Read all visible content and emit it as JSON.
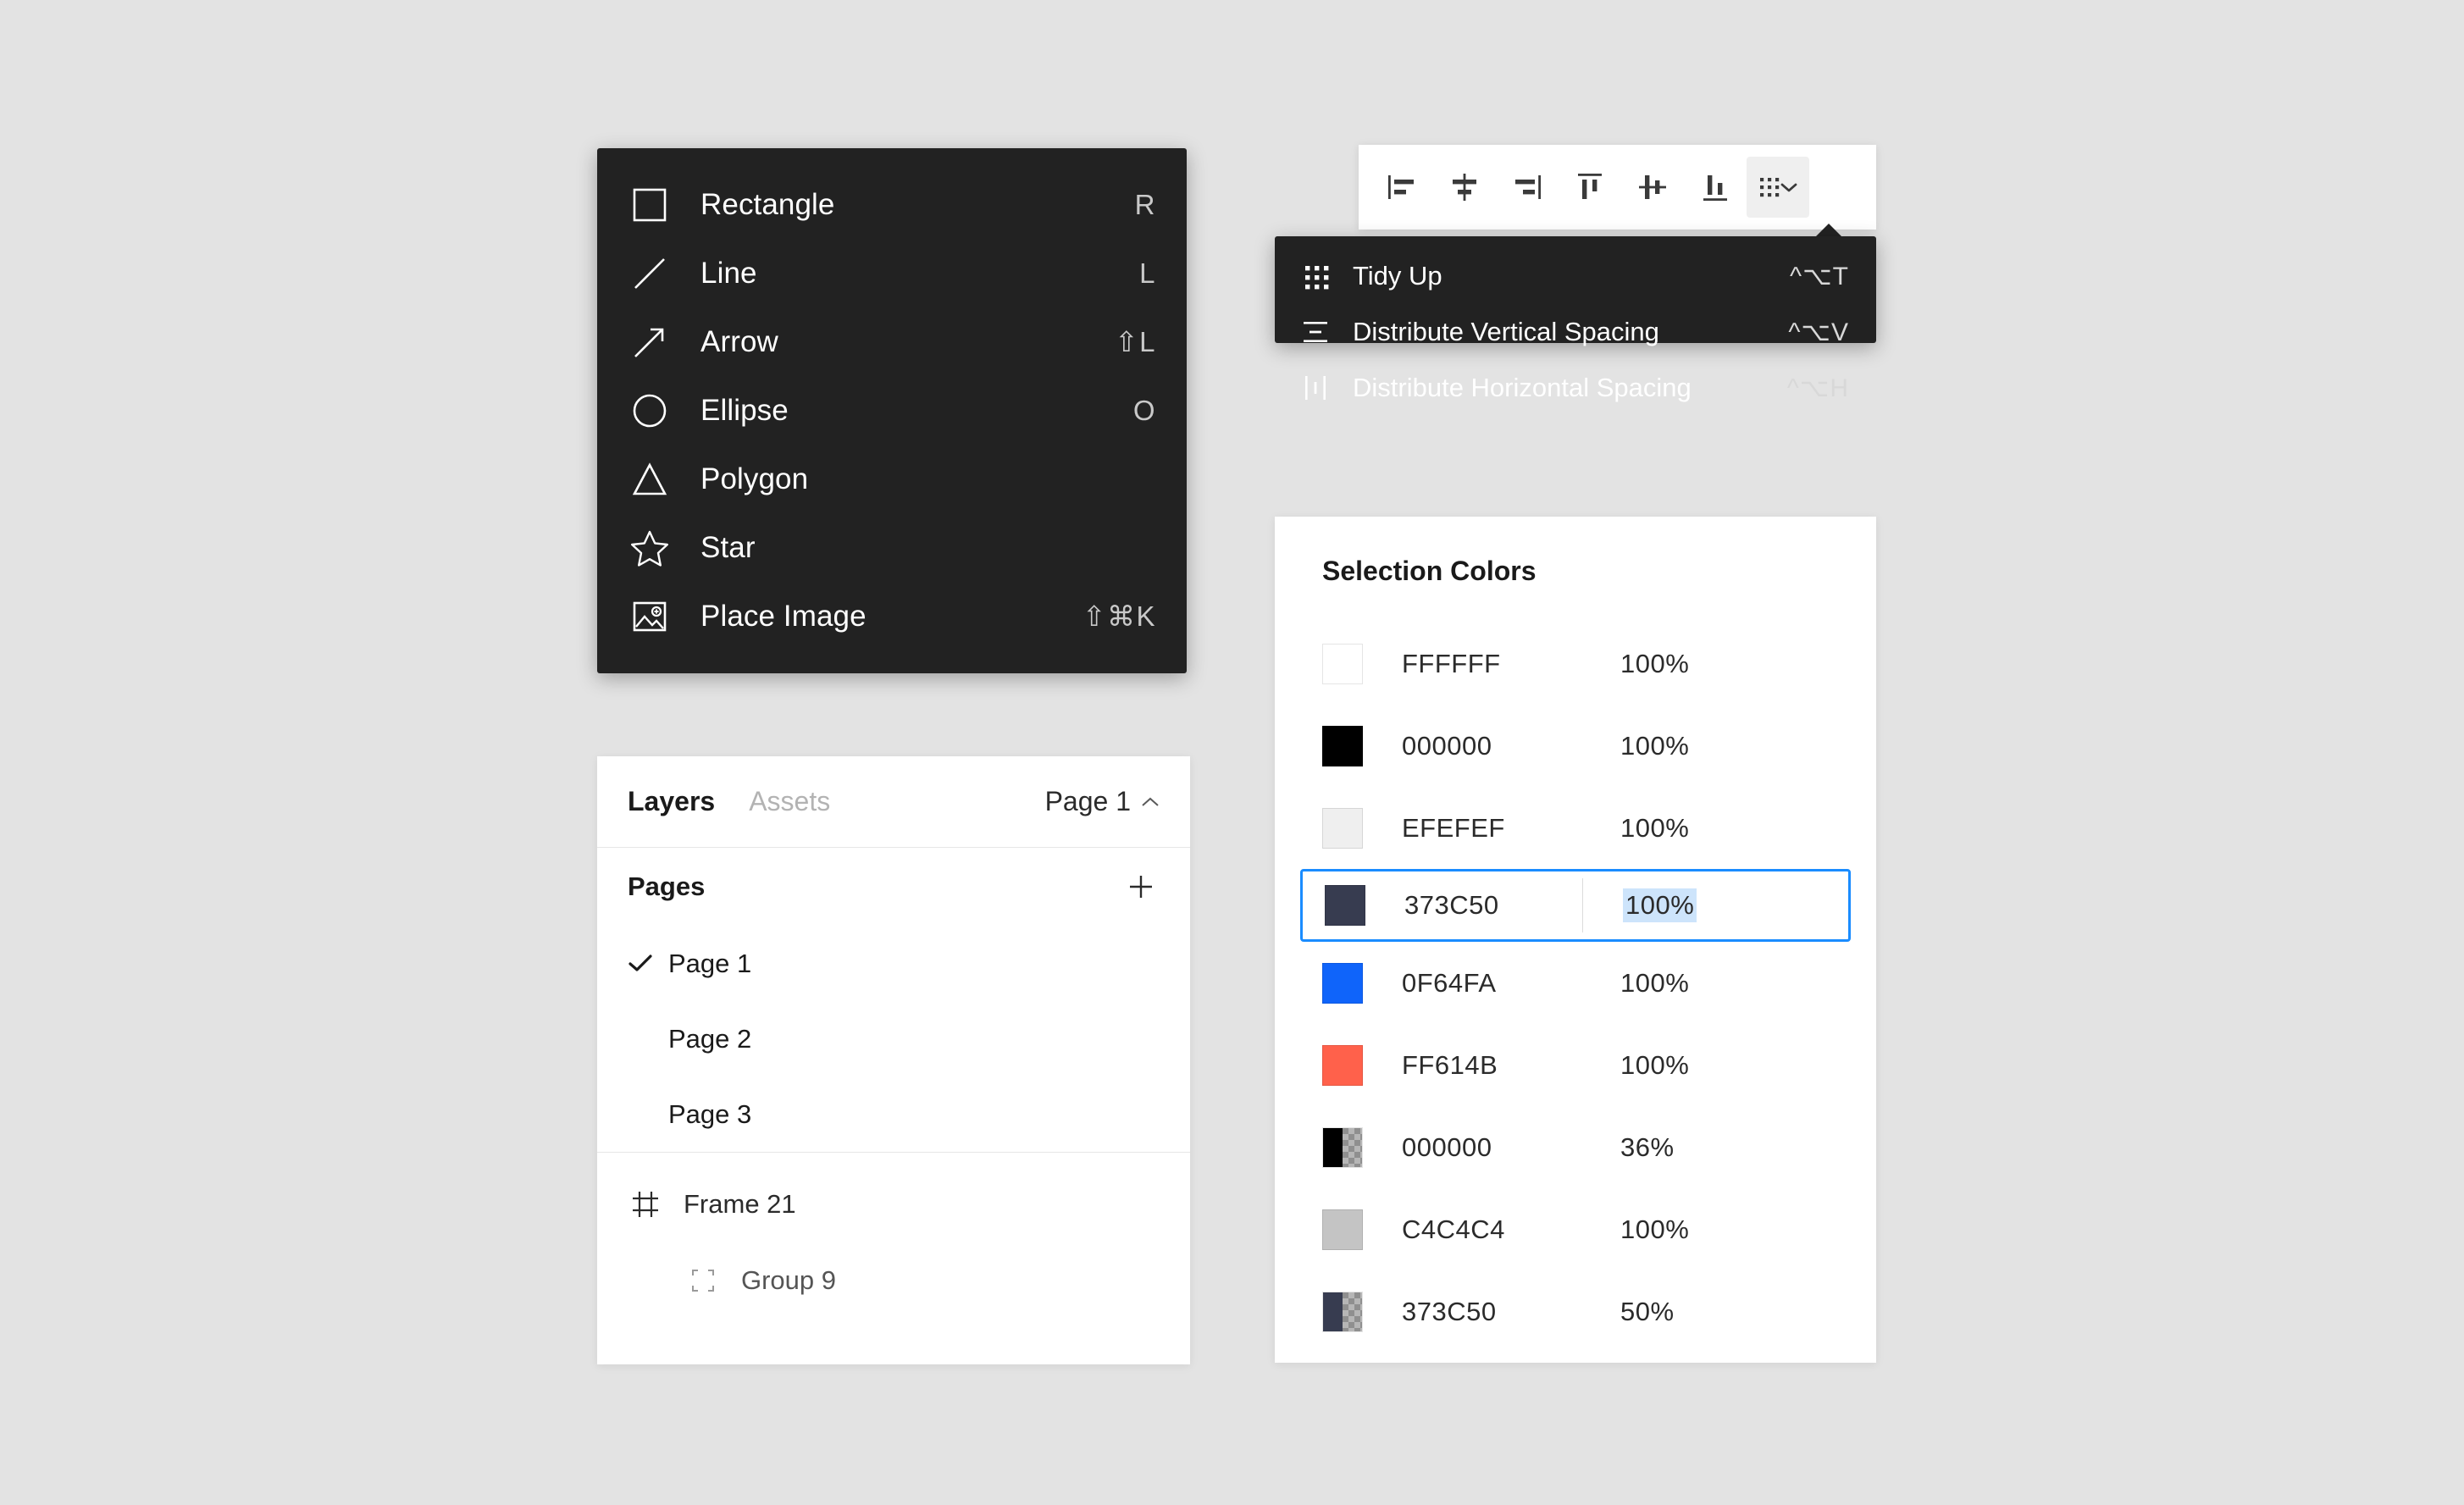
{
  "shapes_menu": {
    "items": [
      {
        "icon": "rectangle-icon",
        "label": "Rectangle",
        "shortcut": "R"
      },
      {
        "icon": "line-icon",
        "label": "Line",
        "shortcut": "L"
      },
      {
        "icon": "arrow-icon",
        "label": "Arrow",
        "shortcut": "⇧L"
      },
      {
        "icon": "ellipse-icon",
        "label": "Ellipse",
        "shortcut": "O"
      },
      {
        "icon": "polygon-icon",
        "label": "Polygon",
        "shortcut": ""
      },
      {
        "icon": "star-icon",
        "label": "Star",
        "shortcut": ""
      },
      {
        "icon": "place-image-icon",
        "label": "Place Image",
        "shortcut": "⇧⌘K"
      }
    ]
  },
  "align_toolbar": {
    "buttons": [
      {
        "icon": "align-left-icon",
        "name": "align-left"
      },
      {
        "icon": "align-horizontal-center-icon",
        "name": "align-horizontal-center"
      },
      {
        "icon": "align-right-icon",
        "name": "align-right"
      },
      {
        "icon": "align-top-icon",
        "name": "align-top"
      },
      {
        "icon": "align-vertical-center-icon",
        "name": "align-vertical-center"
      },
      {
        "icon": "align-bottom-icon",
        "name": "align-bottom"
      },
      {
        "icon": "tidy-up-grid-icon",
        "name": "tidy-up-menu",
        "active": true
      }
    ]
  },
  "align_dropdown": {
    "items": [
      {
        "icon": "tidy-up-grid-icon",
        "label": "Tidy Up",
        "shortcut": "^⌥T"
      },
      {
        "icon": "distribute-vertical-icon",
        "label": "Distribute Vertical Spacing",
        "shortcut": "^⌥V"
      },
      {
        "icon": "distribute-horizontal-icon",
        "label": "Distribute Horizontal Spacing",
        "shortcut": "^⌥H"
      }
    ]
  },
  "layers_panel": {
    "tabs": [
      {
        "label": "Layers",
        "active": true
      },
      {
        "label": "Assets",
        "active": false
      }
    ],
    "page_selector": "Page 1",
    "pages_heading": "Pages",
    "add_button_label": "+",
    "pages": [
      {
        "label": "Page 1",
        "checked": true
      },
      {
        "label": "Page 2",
        "checked": false
      },
      {
        "label": "Page 3",
        "checked": false
      }
    ],
    "tree": [
      {
        "icon": "frame-icon",
        "label": "Frame 21",
        "indent": false
      },
      {
        "icon": "group-icon",
        "label": "Group 9",
        "indent": true
      }
    ]
  },
  "selection_colors": {
    "title": "Selection Colors",
    "rows": [
      {
        "hex": "FFFFFF",
        "opacity": "100%",
        "color": "#FFFFFF",
        "transparent": false,
        "selected": false
      },
      {
        "hex": "000000",
        "opacity": "100%",
        "color": "#000000",
        "transparent": false,
        "selected": false
      },
      {
        "hex": "EFEFEF",
        "opacity": "100%",
        "color": "#EFEFEF",
        "transparent": false,
        "selected": false
      },
      {
        "hex": "373C50",
        "opacity": "100%",
        "color": "#373C50",
        "transparent": false,
        "selected": true
      },
      {
        "hex": "0F64FA",
        "opacity": "100%",
        "color": "#0F64FA",
        "transparent": false,
        "selected": false
      },
      {
        "hex": "FF614B",
        "opacity": "100%",
        "color": "#FF614B",
        "transparent": false,
        "selected": false
      },
      {
        "hex": "000000",
        "opacity": "36%",
        "color": "#000000",
        "transparent": true,
        "selected": false
      },
      {
        "hex": "C4C4C4",
        "opacity": "100%",
        "color": "#C4C4C4",
        "transparent": false,
        "selected": false
      },
      {
        "hex": "373C50",
        "opacity": "50%",
        "color": "#373C50",
        "transparent": true,
        "selected": false
      }
    ]
  },
  "theme": {
    "background": "#E3E3E3",
    "menu_dark": "#222222",
    "panel_white": "#FFFFFF",
    "accent_blue": "#1A8CFF",
    "selection_highlight": "#CDE4FB"
  }
}
